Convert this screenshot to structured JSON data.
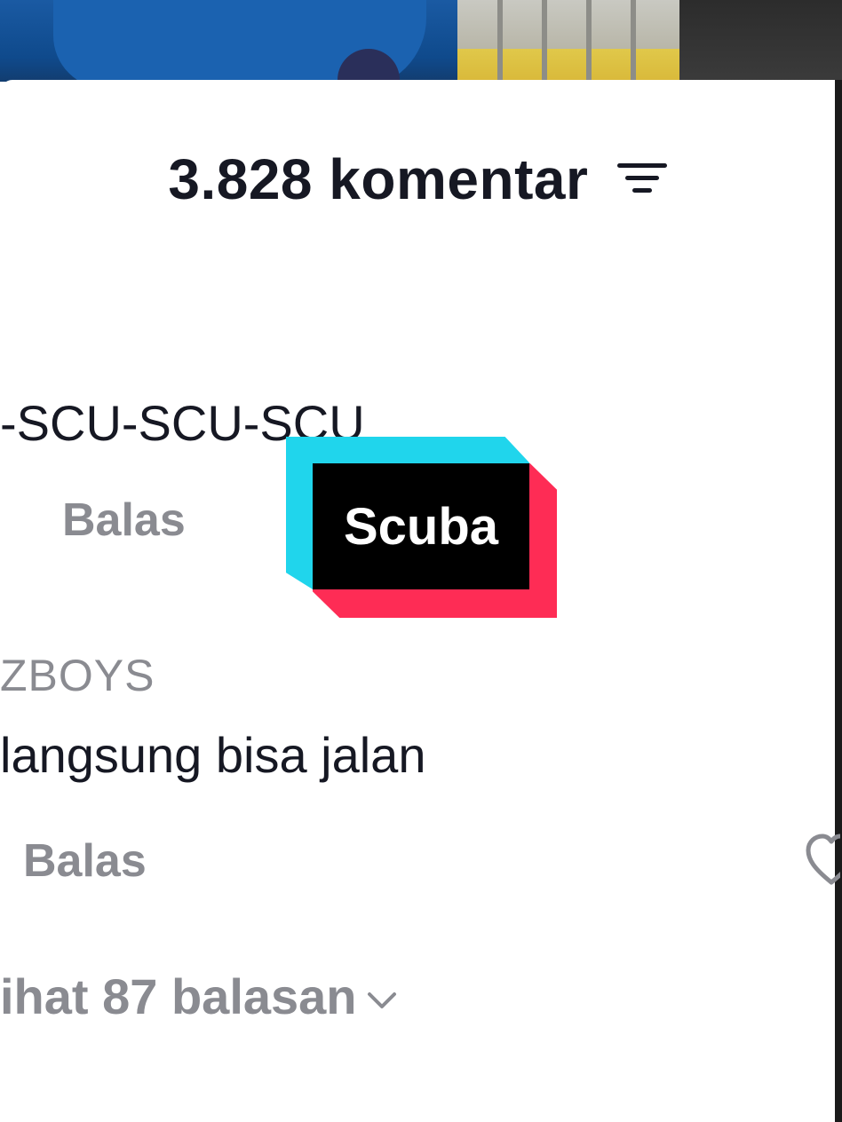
{
  "header": {
    "comment_count_title": "3.828 komentar",
    "filter_icon": "filter-icon"
  },
  "comments": [
    {
      "text": "-SCU-SCU-SCU",
      "reply_label": "Balas"
    },
    {
      "username": "ZBOYS",
      "text": "langsung bisa jalan",
      "reply_label": "Balas",
      "like_icon": "heart-icon",
      "view_replies": "ihat 87 balasan",
      "view_replies_icon": "chevron-down-icon"
    }
  ],
  "sticker": {
    "label": "Scuba",
    "colors": {
      "cyan": "#20d5ec",
      "pink": "#fe2c55",
      "black": "#000000"
    }
  },
  "colors": {
    "primary_text": "#161823",
    "secondary_text": "#8a8b91"
  }
}
